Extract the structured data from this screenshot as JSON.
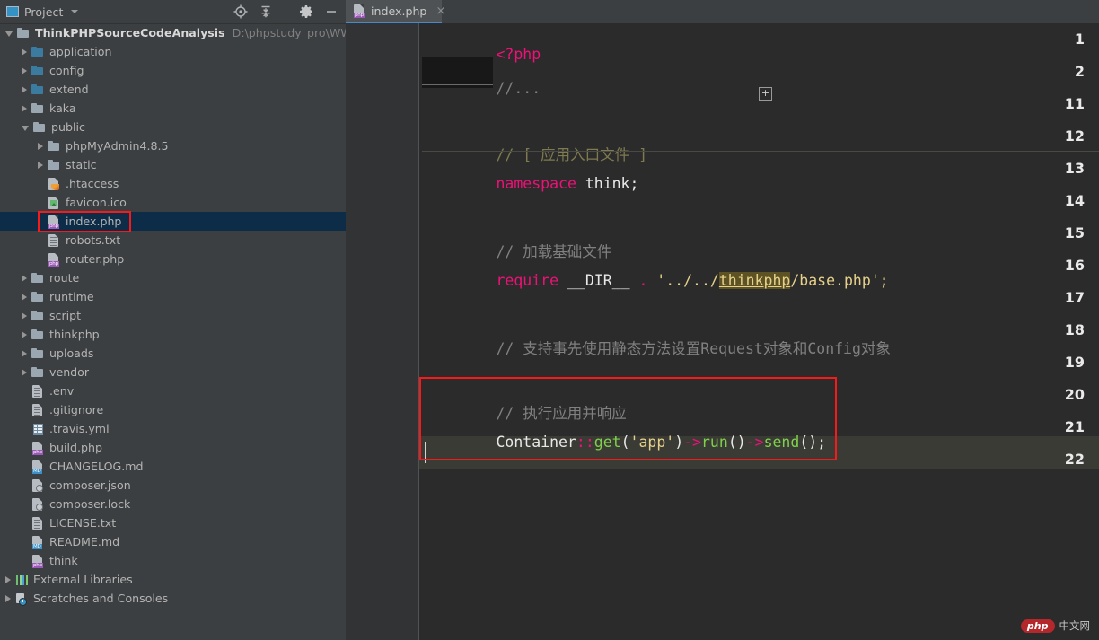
{
  "window": {
    "panel_title": "Project",
    "colors": {
      "panel_bg": "#3c3f41",
      "editor_bg": "#2b2b2b",
      "gutter_bg": "#313335",
      "selection_bg": "#0d2c47",
      "tab_accent": "#4a88c7",
      "annotation_red": "#f81a1a",
      "keyword": "#ee1177",
      "string": "#e7d08a",
      "function": "#7fd14b",
      "comment": "#808080"
    }
  },
  "toolbar": {
    "icons": [
      {
        "name": "locate-target-icon",
        "title": "Select Opened File"
      },
      {
        "name": "collapse-all-icon",
        "title": "Collapse All"
      },
      {
        "name": "gear-icon",
        "title": "Settings"
      },
      {
        "name": "minimize-icon",
        "title": "Hide"
      }
    ]
  },
  "tree": {
    "root": {
      "label": "ThinkPHPSourceCodeAnalysis",
      "path": "D:\\phpstudy_pro\\WWW\\Th"
    },
    "items": [
      {
        "label": "ThinkPHPSourceCodeAnalysis",
        "path": "D:\\phpstudy_pro\\WWW\\Th",
        "indent": 0,
        "arrow": "open",
        "icon": "folder",
        "bold": true,
        "selected": false
      },
      {
        "label": "application",
        "indent": 1,
        "arrow": "closed",
        "icon": "folder-blue",
        "selected": false
      },
      {
        "label": "config",
        "indent": 1,
        "arrow": "closed",
        "icon": "folder-blue",
        "selected": false
      },
      {
        "label": "extend",
        "indent": 1,
        "arrow": "closed",
        "icon": "folder-blue",
        "selected": false
      },
      {
        "label": "kaka",
        "indent": 1,
        "arrow": "closed",
        "icon": "folder",
        "selected": false
      },
      {
        "label": "public",
        "indent": 1,
        "arrow": "open",
        "icon": "folder",
        "selected": false
      },
      {
        "label": "phpMyAdmin4.8.5",
        "indent": 2,
        "arrow": "closed",
        "icon": "folder",
        "selected": false
      },
      {
        "label": "static",
        "indent": 2,
        "arrow": "closed",
        "icon": "folder",
        "selected": false
      },
      {
        "label": ".htaccess",
        "indent": 2,
        "arrow": "none",
        "icon": "htaccess",
        "selected": false
      },
      {
        "label": "favicon.ico",
        "indent": 2,
        "arrow": "none",
        "icon": "image",
        "selected": false
      },
      {
        "label": "index.php",
        "indent": 2,
        "arrow": "none",
        "icon": "php",
        "selected": true
      },
      {
        "label": "robots.txt",
        "indent": 2,
        "arrow": "none",
        "icon": "text",
        "selected": false
      },
      {
        "label": "router.php",
        "indent": 2,
        "arrow": "none",
        "icon": "php",
        "selected": false
      },
      {
        "label": "route",
        "indent": 1,
        "arrow": "closed",
        "icon": "folder",
        "selected": false
      },
      {
        "label": "runtime",
        "indent": 1,
        "arrow": "closed",
        "icon": "folder",
        "selected": false
      },
      {
        "label": "script",
        "indent": 1,
        "arrow": "closed",
        "icon": "folder",
        "selected": false
      },
      {
        "label": "thinkphp",
        "indent": 1,
        "arrow": "closed",
        "icon": "folder",
        "selected": false
      },
      {
        "label": "uploads",
        "indent": 1,
        "arrow": "closed",
        "icon": "folder",
        "selected": false
      },
      {
        "label": "vendor",
        "indent": 1,
        "arrow": "closed",
        "icon": "folder",
        "selected": false
      },
      {
        "label": ".env",
        "indent": 1,
        "arrow": "none",
        "icon": "text",
        "selected": false
      },
      {
        "label": ".gitignore",
        "indent": 1,
        "arrow": "none",
        "icon": "text",
        "selected": false
      },
      {
        "label": ".travis.yml",
        "indent": 1,
        "arrow": "none",
        "icon": "yml",
        "selected": false
      },
      {
        "label": "build.php",
        "indent": 1,
        "arrow": "none",
        "icon": "php",
        "selected": false
      },
      {
        "label": "CHANGELOG.md",
        "indent": 1,
        "arrow": "none",
        "icon": "md",
        "selected": false
      },
      {
        "label": "composer.json",
        "indent": 1,
        "arrow": "none",
        "icon": "json",
        "selected": false
      },
      {
        "label": "composer.lock",
        "indent": 1,
        "arrow": "none",
        "icon": "json",
        "selected": false
      },
      {
        "label": "LICENSE.txt",
        "indent": 1,
        "arrow": "none",
        "icon": "text",
        "selected": false
      },
      {
        "label": "README.md",
        "indent": 1,
        "arrow": "none",
        "icon": "md",
        "selected": false
      },
      {
        "label": "think",
        "indent": 1,
        "arrow": "none",
        "icon": "php",
        "selected": false
      },
      {
        "label": "External Libraries",
        "indent": 0,
        "arrow": "closed",
        "icon": "extlib",
        "selected": false
      },
      {
        "label": "Scratches and Consoles",
        "indent": 0,
        "arrow": "closed",
        "icon": "scratch",
        "selected": false
      }
    ]
  },
  "editor": {
    "tab": {
      "label": "index.php",
      "close": "×",
      "icon": "php-file-icon"
    },
    "line_numbers": [
      "1",
      "2",
      "11",
      "12",
      "13",
      "14",
      "15",
      "16",
      "17",
      "18",
      "19",
      "20",
      "21",
      "22"
    ],
    "fold_marker": "+",
    "folded_text": "//...",
    "lines": [
      {
        "num": "1",
        "text": "<?php"
      },
      {
        "num": "2",
        "text": "//..."
      },
      {
        "num": "11",
        "text": ""
      },
      {
        "num": "12",
        "text": "// [ 应用入口文件 ]"
      },
      {
        "num": "13",
        "text": "namespace think;"
      },
      {
        "num": "14",
        "text": ""
      },
      {
        "num": "15",
        "text": "// 加载基础文件"
      },
      {
        "num": "16",
        "text": "require __DIR__ . '../../thinkphp/base.php';"
      },
      {
        "num": "17",
        "text": ""
      },
      {
        "num": "18",
        "text": "// 支持事先使用静态方法设置Request对象和Config对象"
      },
      {
        "num": "19",
        "text": ""
      },
      {
        "num": "20",
        "text": "// 执行应用并响应"
      },
      {
        "num": "21",
        "text": "Container::get('app')->run()->send();"
      },
      {
        "num": "22",
        "text": ""
      }
    ],
    "tokens": {
      "php_open": "<?php",
      "comment_entry": "// [ 应用入口文件 ]",
      "kw_namespace": "namespace",
      "ns_think": " think;",
      "comment_load_base": "// 加载基础文件",
      "kw_require": "require",
      "dir_const": " __DIR__ ",
      "dot": ".",
      "str_prefix": " '../../",
      "str_highlight": "thinkphp",
      "str_suffix": "/base.php';",
      "comment_request": "// 支持事先使用静态方法设置Request对象和Config对象",
      "comment_run": "// 执行应用并响应",
      "cls_container": "Container",
      "dbl_colon": "::",
      "fn_get": "get",
      "paren_open": "(",
      "str_app": "'app'",
      "paren_close": ")",
      "arrow1": "->",
      "fn_run": "run",
      "empty_parens": "()",
      "arrow2": "->",
      "fn_send": "send",
      "tail": "();"
    }
  },
  "watermark": {
    "badge": "php",
    "text": "中文网"
  }
}
